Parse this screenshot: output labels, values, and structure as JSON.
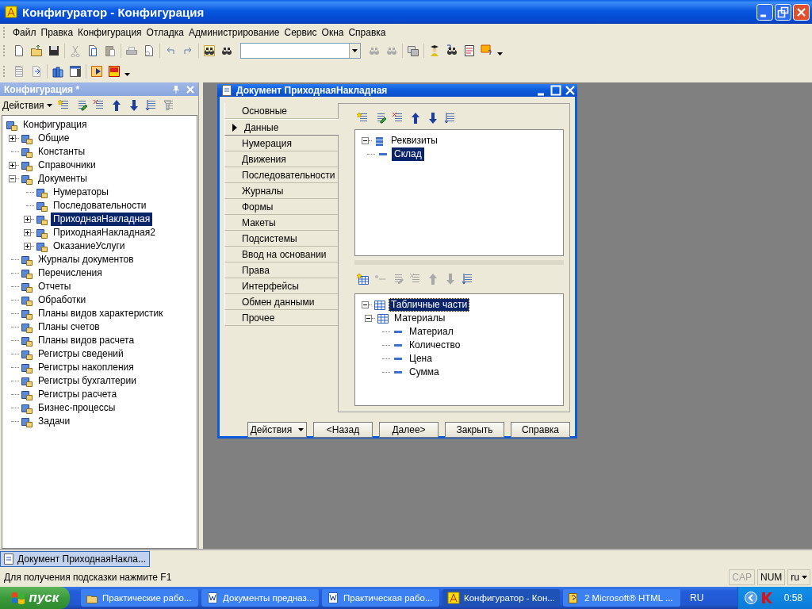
{
  "window": {
    "title": "Конфигуратор - Конфигурация"
  },
  "menu": [
    "Файл",
    "Правка",
    "Конфигурация",
    "Отладка",
    "Администрирование",
    "Сервис",
    "Окна",
    "Справка"
  ],
  "config_panel": {
    "title": "Конфигурация *",
    "actions": "Действия",
    "tree": [
      {
        "label": "Конфигурация",
        "selected": false,
        "children": [
          {
            "label": "Общие",
            "expanded": false,
            "selected": false
          },
          {
            "label": "Константы",
            "selected": false
          },
          {
            "label": "Справочники",
            "expanded": false,
            "selected": false
          },
          {
            "label": "Документы",
            "expanded": true,
            "selected": false,
            "children": [
              {
                "label": "Нумераторы",
                "selected": false
              },
              {
                "label": "Последовательности",
                "selected": false
              },
              {
                "label": "ПриходнаяНакладная",
                "expanded": false,
                "selected": true
              },
              {
                "label": "ПриходнаяНакладная2",
                "expanded": false,
                "selected": false
              },
              {
                "label": "ОказаниеУслуги",
                "expanded": false,
                "selected": false
              }
            ]
          },
          {
            "label": "Журналы документов",
            "selected": false
          },
          {
            "label": "Перечисления",
            "selected": false
          },
          {
            "label": "Отчеты",
            "selected": false
          },
          {
            "label": "Обработки",
            "selected": false
          },
          {
            "label": "Планы видов характеристик",
            "selected": false
          },
          {
            "label": "Планы счетов",
            "selected": false
          },
          {
            "label": "Планы видов расчета",
            "selected": false
          },
          {
            "label": "Регистры сведений",
            "selected": false
          },
          {
            "label": "Регистры накопления",
            "selected": false
          },
          {
            "label": "Регистры бухгалтерии",
            "selected": false
          },
          {
            "label": "Регистры расчета",
            "selected": false
          },
          {
            "label": "Бизнес-процессы",
            "selected": false
          },
          {
            "label": "Задачи",
            "selected": false
          }
        ]
      }
    ]
  },
  "dialog": {
    "title": "Документ ПриходнаяНакладная",
    "tabs": [
      {
        "label": "Основные",
        "selected": false
      },
      {
        "label": "Данные",
        "selected": true
      },
      {
        "label": "Нумерация",
        "selected": false
      },
      {
        "label": "Движения",
        "selected": false
      },
      {
        "label": "Последовательности",
        "selected": false
      },
      {
        "label": "Журналы",
        "selected": false
      },
      {
        "label": "Формы",
        "selected": false
      },
      {
        "label": "Макеты",
        "selected": false
      },
      {
        "label": "Подсистемы",
        "selected": false
      },
      {
        "label": "Ввод на основании",
        "selected": false
      },
      {
        "label": "Права",
        "selected": false
      },
      {
        "label": "Интерфейсы",
        "selected": false
      },
      {
        "label": "Обмен данными",
        "selected": false
      },
      {
        "label": "Прочее",
        "selected": false
      }
    ],
    "attributes_tree": [
      {
        "label": "Реквизиты",
        "expanded": true,
        "selected": false,
        "children": [
          {
            "label": "Склад",
            "selected": true
          }
        ]
      }
    ],
    "tabular_tree": [
      {
        "label": "Табличные части",
        "expanded": true,
        "selected": true,
        "focused": true,
        "children": [
          {
            "label": "Материалы",
            "expanded": true,
            "selected": false,
            "children": [
              {
                "label": "Материал",
                "selected": false
              },
              {
                "label": "Количество",
                "selected": false
              },
              {
                "label": "Цена",
                "selected": false
              },
              {
                "label": "Сумма",
                "selected": false
              }
            ]
          }
        ]
      }
    ],
    "buttons": [
      {
        "label": "Действия",
        "kind": "menu"
      },
      {
        "label": "<Назад",
        "kind": "push"
      },
      {
        "label": "Далее>",
        "kind": "push"
      },
      {
        "label": "Закрыть",
        "kind": "push"
      },
      {
        "label": "Справка",
        "kind": "push"
      }
    ]
  },
  "windows_bar": [
    {
      "label": "Документ ПриходнаяНакла...",
      "selected": true
    }
  ],
  "status_bar": {
    "hint": "Для получения подсказки нажмите F1",
    "indicators": [
      {
        "label": "CAP",
        "on": false
      },
      {
        "label": "NUM",
        "on": true
      }
    ],
    "language": "ru"
  },
  "taskbar": {
    "start": "пуск",
    "tasks": [
      {
        "label": "Практические рабо...",
        "kind": "folder",
        "selected": false
      },
      {
        "label": "Документы предназ...",
        "kind": "document",
        "selected": false
      },
      {
        "label": "Практическая рабо...",
        "kind": "document",
        "selected": false
      },
      {
        "label": "Конфигуратор - Кон...",
        "kind": "app",
        "selected": true
      },
      {
        "label": "2 Microsoft® HTML ...",
        "kind": "help",
        "selected": false
      }
    ],
    "language": "RU",
    "clock": "0:58"
  }
}
